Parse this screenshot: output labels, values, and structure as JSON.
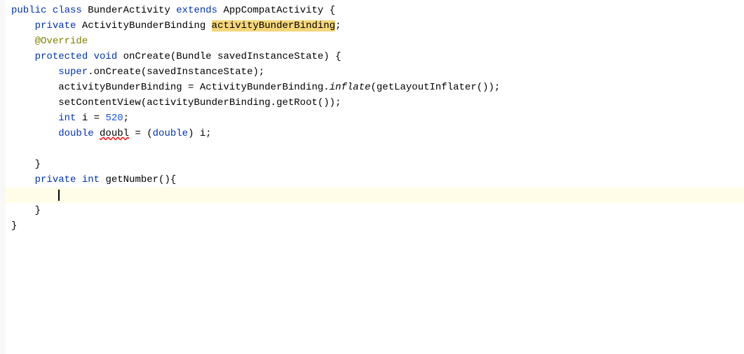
{
  "editor": {
    "background": "#ffffff",
    "lines": [
      {
        "id": 1,
        "highlighted": false,
        "content": "public class BunderActivity extends AppCompatActivity {"
      },
      {
        "id": 2,
        "highlighted": false,
        "content": "    private ActivityBunderBinding activityBunderBinding;"
      },
      {
        "id": 3,
        "highlighted": false,
        "content": "    @Override"
      },
      {
        "id": 4,
        "highlighted": false,
        "content": "    protected void onCreate(Bundle savedInstanceState) {"
      },
      {
        "id": 5,
        "highlighted": false,
        "content": "        super.onCreate(savedInstanceState);"
      },
      {
        "id": 6,
        "highlighted": false,
        "content": "        activityBunderBinding = ActivityBunderBinding.inflate(getLayoutInflater());"
      },
      {
        "id": 7,
        "highlighted": false,
        "content": "        setContentView(activityBunderBinding.getRoot());"
      },
      {
        "id": 8,
        "highlighted": false,
        "content": "        int i = 520;"
      },
      {
        "id": 9,
        "highlighted": false,
        "content": "        double doubl = (double) i;"
      },
      {
        "id": 10,
        "highlighted": false,
        "content": ""
      },
      {
        "id": 11,
        "highlighted": false,
        "content": "    }"
      },
      {
        "id": 12,
        "highlighted": false,
        "content": "    private int getNumber(){"
      },
      {
        "id": 13,
        "highlighted": true,
        "content": "        "
      },
      {
        "id": 14,
        "highlighted": false,
        "content": "    }"
      },
      {
        "id": 15,
        "highlighted": false,
        "content": "}"
      }
    ]
  }
}
